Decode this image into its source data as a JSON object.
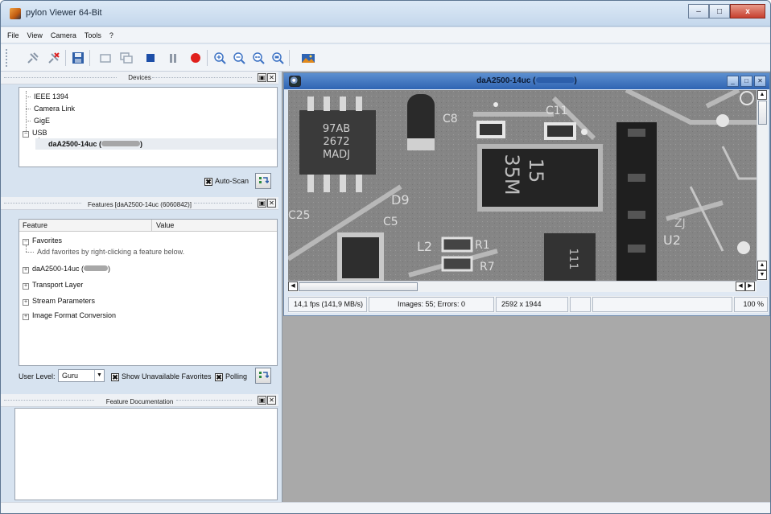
{
  "window": {
    "title": "pylon Viewer 64-Bit",
    "min": "–",
    "max": "□",
    "close": "x"
  },
  "menu": [
    "File",
    "View",
    "Camera",
    "Tools",
    "?"
  ],
  "panels": {
    "devices": {
      "title": "Devices",
      "items": [
        "IEEE 1394",
        "Camera Link",
        "GigE",
        "USB"
      ],
      "usb_child_prefix": "daA2500-14uc (",
      "usb_child_suffix": ")",
      "auto_scan_label": "Auto-Scan",
      "auto_scan_checked": true
    },
    "features": {
      "title": "Features [daA2500-14uc (6060842)]",
      "columns": [
        "Feature",
        "Value"
      ],
      "favorites_label": "Favorites",
      "favorites_hint": "Add favorites by right-clicking a feature below.",
      "camera_prefix": "daA2500-14uc (",
      "camera_suffix": ")",
      "groups": [
        "Transport Layer",
        "Stream Parameters",
        "Image Format Conversion"
      ],
      "user_level_label": "User Level:",
      "user_level_value": "Guru",
      "show_unavailable_label": "Show Unavailable Favorites",
      "polling_label": "Polling"
    },
    "documentation": {
      "title": "Feature Documentation"
    }
  },
  "image_window": {
    "title_prefix": "daA2500-14uc (",
    "title_suffix": ")",
    "pcb_labels": [
      "97AB",
      "2672",
      "MADJ",
      "C8",
      "C11",
      "15",
      "35M",
      "D9",
      "C25",
      "C5",
      "L2",
      "R1",
      "R7",
      "111",
      "U2",
      "ZJ"
    ],
    "status": {
      "fps": "14,1 fps (141,9 MB/s)",
      "images": "Images: 55; Errors: 0",
      "resolution": "2592 x 1944",
      "zoom": "100 %"
    }
  },
  "colors": {
    "titlebar": "#c4d7ec",
    "mdi_background": "#a9a9a9",
    "record_red": "#e0201c",
    "stop_blue": "#1d4ea8"
  }
}
